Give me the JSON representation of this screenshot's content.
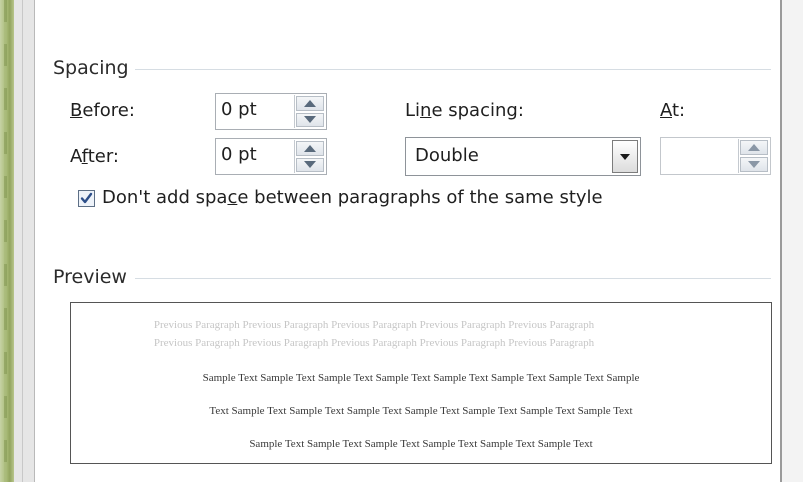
{
  "spacing": {
    "title": "Spacing",
    "before": {
      "label_pre": "",
      "label_accel": "B",
      "label_post": "efore:",
      "value": "0 pt"
    },
    "after": {
      "label_pre": "A",
      "label_accel": "f",
      "label_post": "ter:",
      "value": "0 pt"
    },
    "line_spacing": {
      "label_pre": "Li",
      "label_accel": "n",
      "label_post": "e spacing:",
      "value": "Double"
    },
    "at": {
      "label_pre": "",
      "label_accel": "A",
      "label_post": "t:",
      "value": ""
    },
    "dont_add_space": {
      "label_pre": "Don't add spa",
      "label_accel": "c",
      "label_post": "e between paragraphs of the same style",
      "checked": true
    }
  },
  "preview": {
    "title": "Preview",
    "previous_lines": [
      "Previous Paragraph Previous Paragraph Previous Paragraph Previous Paragraph Previous Paragraph",
      "Previous Paragraph Previous Paragraph Previous Paragraph Previous Paragraph Previous Paragraph"
    ],
    "sample_lines": [
      "Sample Text Sample Text Sample Text Sample Text Sample Text Sample Text Sample Text Sample",
      "Text Sample Text Sample Text Sample Text Sample Text Sample Text Sample Text Sample Text",
      "Sample Text Sample Text Sample Text Sample Text Sample Text Sample Text"
    ]
  },
  "icons": {
    "spin_up": "spin-up-icon",
    "spin_down": "spin-down-icon",
    "dropdown": "chevron-down-icon",
    "check": "checkmark-icon"
  },
  "colors": {
    "frame_green": "#a9bb77",
    "checkmark": "#2d4f8a",
    "rule": "#d6dde3"
  }
}
